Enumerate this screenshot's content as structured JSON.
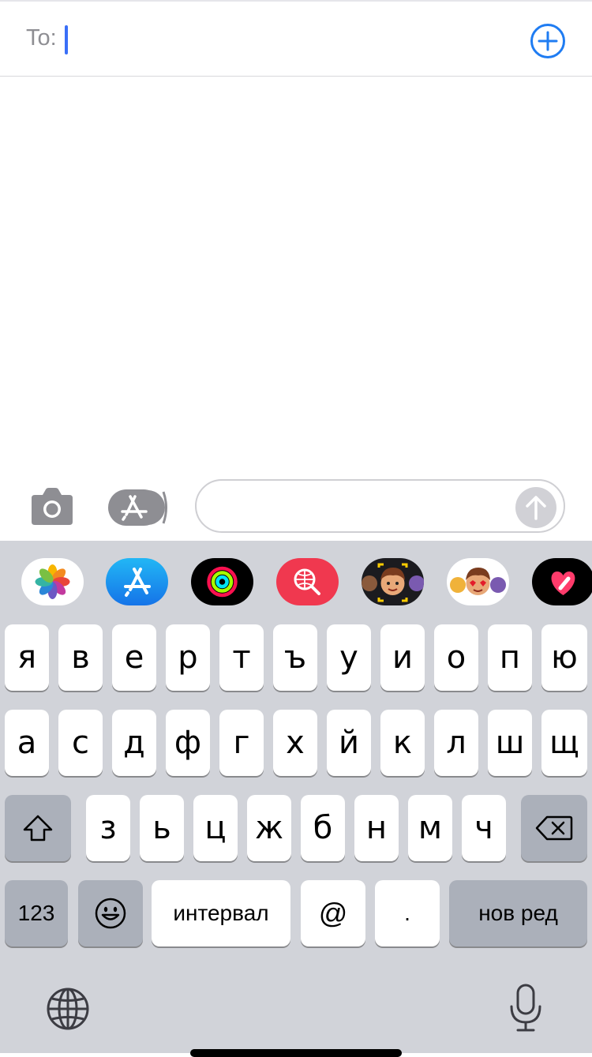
{
  "header": {
    "to_label": "To:",
    "add_icon": "plus-circle-icon",
    "accent": "#1f7cf2"
  },
  "composer": {
    "camera_icon": "camera-icon",
    "apps_icon": "app-store-icon",
    "send_icon": "arrow-up-icon",
    "input_value": ""
  },
  "app_strip": [
    {
      "name": "Photos",
      "icon": "photos-icon"
    },
    {
      "name": "App Store",
      "icon": "app-store-icon"
    },
    {
      "name": "Activity",
      "icon": "activity-rings-icon"
    },
    {
      "name": "Images Search",
      "icon": "globe-search-icon"
    },
    {
      "name": "Memoji",
      "icon": "memoji-icon"
    },
    {
      "name": "Memoji Stickers",
      "icon": "memoji-stickers-icon"
    },
    {
      "name": "Digital Touch",
      "icon": "digital-touch-icon"
    }
  ],
  "keyboard": {
    "row1": [
      "я",
      "в",
      "е",
      "р",
      "т",
      "ъ",
      "у",
      "и",
      "о",
      "п",
      "ю"
    ],
    "row2": [
      "а",
      "с",
      "д",
      "ф",
      "г",
      "х",
      "й",
      "к",
      "л",
      "ш",
      "щ"
    ],
    "row3": [
      "з",
      "ь",
      "ц",
      "ж",
      "б",
      "н",
      "м",
      "ч"
    ],
    "shift_icon": "shift-icon",
    "delete_icon": "backspace-icon",
    "numbers_label": "123",
    "emoji_icon": "emoji-icon",
    "space_label": "интервал",
    "at_label": "@",
    "dot_label": ".",
    "return_label": "нов ред",
    "globe_icon": "globe-icon",
    "mic_icon": "microphone-icon"
  }
}
